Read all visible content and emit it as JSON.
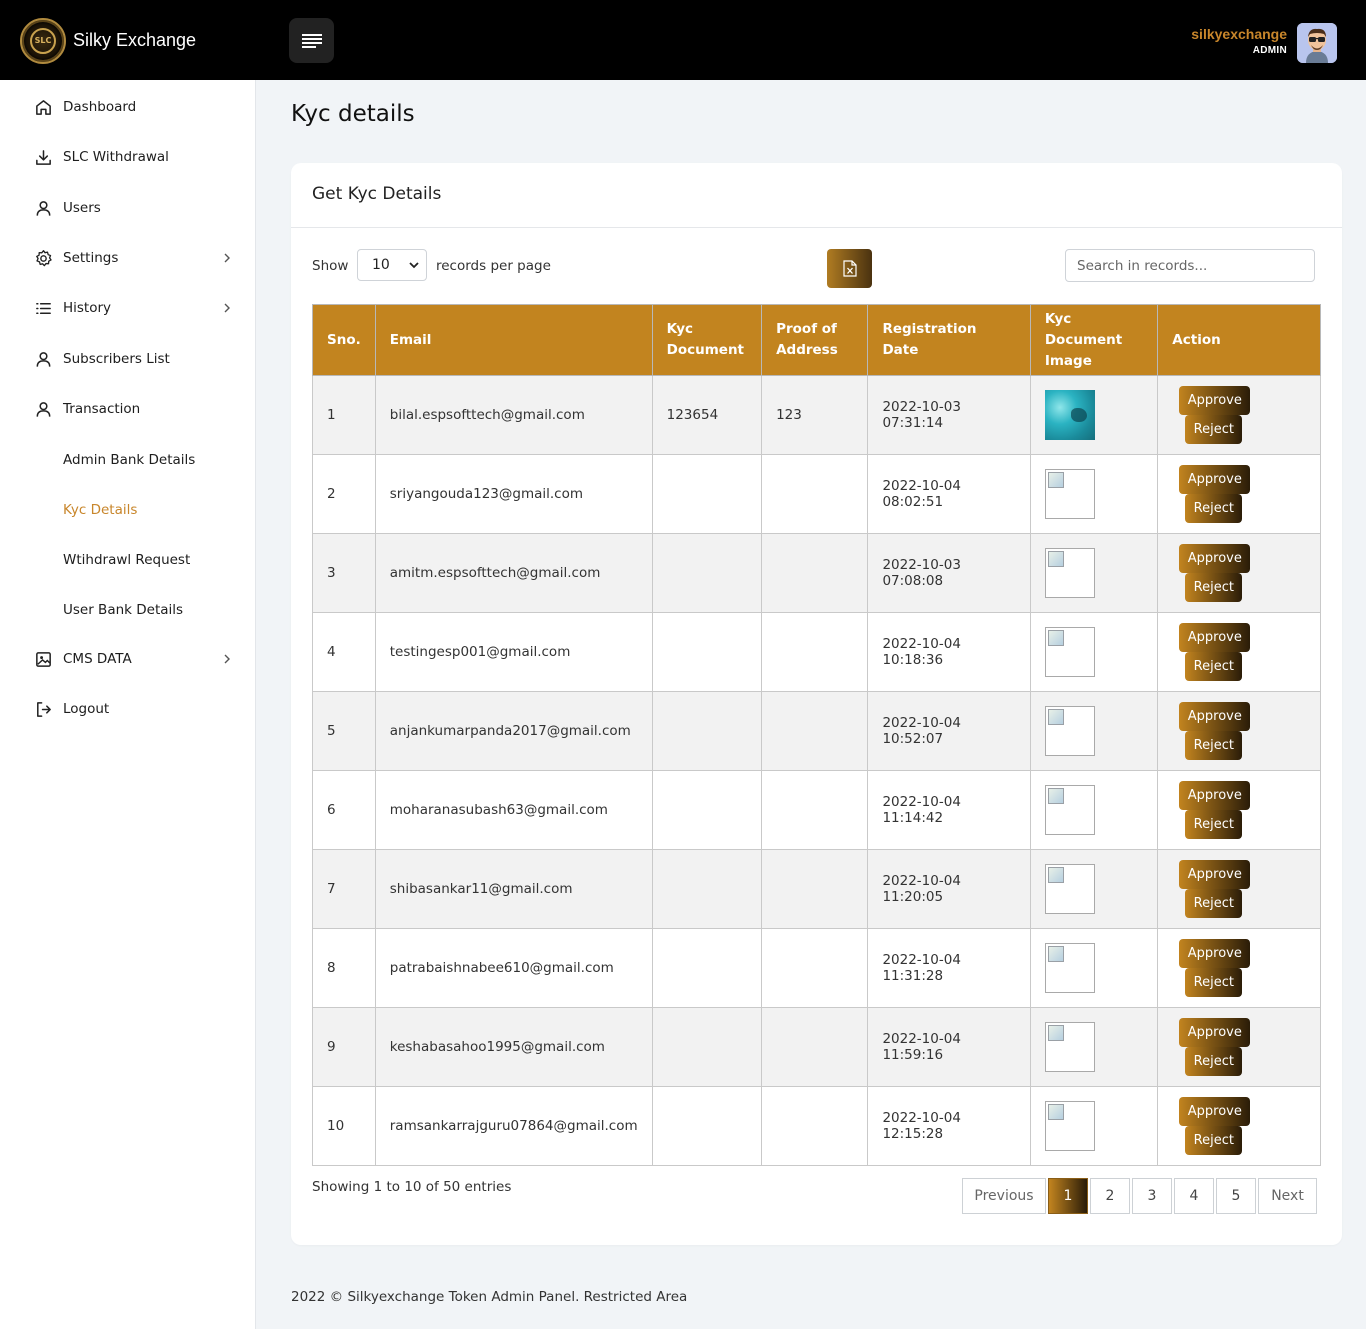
{
  "header": {
    "brand": "Silky Exchange",
    "logo_text": "SLC",
    "user_name": "silkyexchange",
    "user_role": "ADMIN"
  },
  "sidebar": {
    "items": [
      {
        "label": "Dashboard",
        "icon": "home-icon"
      },
      {
        "label": "SLC Withdrawal",
        "icon": "download-icon"
      },
      {
        "label": "Users",
        "icon": "user-icon"
      },
      {
        "label": "Settings",
        "icon": "gear-icon"
      },
      {
        "label": "History",
        "icon": "list-icon"
      },
      {
        "label": "Subscribers List",
        "icon": "user-icon"
      },
      {
        "label": "Transaction",
        "icon": "user-icon"
      },
      {
        "label": "Admin Bank Details"
      },
      {
        "label": "Kyc Details",
        "active": true
      },
      {
        "label": "Wtihdrawl Request"
      },
      {
        "label": "User Bank Details"
      },
      {
        "label": "CMS DATA",
        "icon": "image-icon"
      },
      {
        "label": "Logout",
        "icon": "logout-icon"
      }
    ]
  },
  "page": {
    "title": "Kyc details",
    "card_title": "Get Kyc Details",
    "show_label": "Show",
    "page_size": "10",
    "records_label": "records per page",
    "search_placeholder": "Search in records...",
    "showing": "Showing 1 to 10 of 50 entries",
    "footer": "2022 © Silkyexchange Token Admin Panel. Restricted Area"
  },
  "table": {
    "headers": [
      "Sno.",
      "Email",
      "Kyc Document",
      "Proof of Address",
      "Registration Date",
      "Kyc Document Image",
      "Action"
    ],
    "approve_label": "Approve",
    "reject_label": "Reject",
    "rows": [
      {
        "sno": "1",
        "email": "bilal.espsofttech@gmail.com",
        "kyc": "123654",
        "proof": "123",
        "date": "2022-10-03 07:31:14",
        "image": "loaded"
      },
      {
        "sno": "2",
        "email": "sriyangouda123@gmail.com",
        "kyc": "",
        "proof": "",
        "date": "2022-10-04 08:02:51",
        "image": "broken"
      },
      {
        "sno": "3",
        "email": "amitm.espsofttech@gmail.com",
        "kyc": "",
        "proof": "",
        "date": "2022-10-03 07:08:08",
        "image": "broken"
      },
      {
        "sno": "4",
        "email": "testingesp001@gmail.com",
        "kyc": "",
        "proof": "",
        "date": "2022-10-04 10:18:36",
        "image": "broken"
      },
      {
        "sno": "5",
        "email": "anjankumarpanda2017@gmail.com",
        "kyc": "",
        "proof": "",
        "date": "2022-10-04 10:52:07",
        "image": "broken"
      },
      {
        "sno": "6",
        "email": "moharanasubash63@gmail.com",
        "kyc": "",
        "proof": "",
        "date": "2022-10-04 11:14:42",
        "image": "broken"
      },
      {
        "sno": "7",
        "email": "shibasankar11@gmail.com",
        "kyc": "",
        "proof": "",
        "date": "2022-10-04 11:20:05",
        "image": "broken"
      },
      {
        "sno": "8",
        "email": "patrabaishnabee610@gmail.com",
        "kyc": "",
        "proof": "",
        "date": "2022-10-04 11:31:28",
        "image": "broken"
      },
      {
        "sno": "9",
        "email": "keshabasahoo1995@gmail.com",
        "kyc": "",
        "proof": "",
        "date": "2022-10-04 11:59:16",
        "image": "broken"
      },
      {
        "sno": "10",
        "email": "ramsankarrajguru07864@gmail.com",
        "kyc": "",
        "proof": "",
        "date": "2022-10-04 12:15:28",
        "image": "broken"
      }
    ]
  },
  "pagination": {
    "previous": "Previous",
    "next": "Next",
    "pages": [
      "1",
      "2",
      "3",
      "4",
      "5"
    ],
    "current": "1"
  },
  "colors": {
    "accent": "#c2841f",
    "active_nav": "#c8862b",
    "topbar": "#000000"
  }
}
